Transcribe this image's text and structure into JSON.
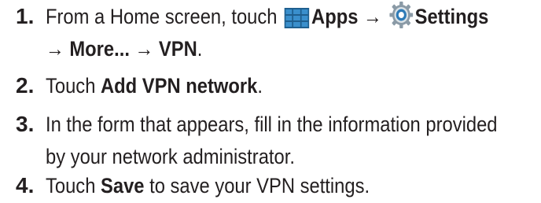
{
  "steps": [
    {
      "number": "1.",
      "line1": {
        "pre": "From a Home screen, touch ",
        "apps_label": "Apps",
        "arrow1": " → ",
        "settings_label": "Settings"
      },
      "line2": {
        "arrow": "→ ",
        "more": "More...",
        "arrow2": " → ",
        "vpn": "VPN",
        "end": "."
      },
      "icons": [
        "apps-grid-icon",
        "settings-gear-icon"
      ]
    },
    {
      "number": "2.",
      "pre": "Touch ",
      "bold": "Add VPN network",
      "post": "."
    },
    {
      "number": "3.",
      "line1": "In the form that appears, fill in the information provided",
      "line2": "by your network administrator."
    },
    {
      "number": "4.",
      "pre": "Touch ",
      "bold": "Save",
      "post": " to save your VPN settings."
    }
  ],
  "colors": {
    "text": "#231f20",
    "apps_icon": "#2e7bb7",
    "settings_icon": "#5a6e7d"
  }
}
